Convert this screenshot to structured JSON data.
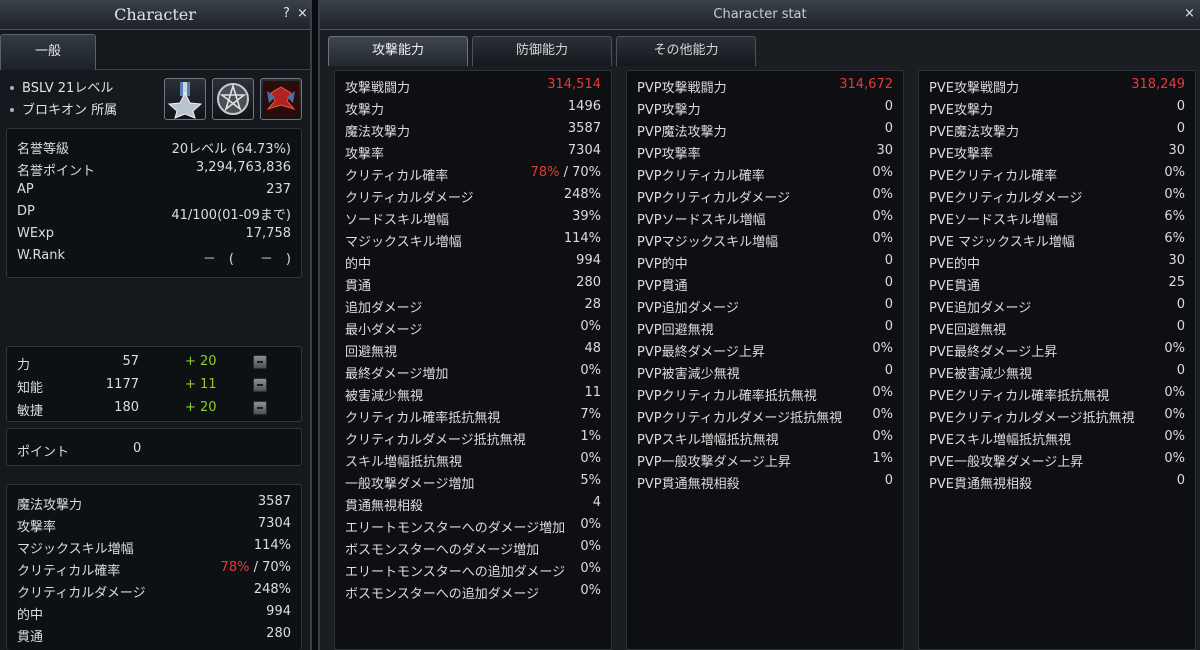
{
  "left": {
    "title": "Character",
    "help_label": "?",
    "close_label": "×",
    "tab_general": "一般",
    "info": [
      "BSLV 21レベル",
      "ブロキオン 所属"
    ],
    "emblems": [
      "medal-star-icon",
      "pentagram-icon",
      "legion-crest-icon"
    ],
    "honor": [
      {
        "k": "名誉等級",
        "v": "20レベル (64.73%)"
      },
      {
        "k": "名誉ポイント",
        "v": "3,294,763,836"
      },
      {
        "k": "AP",
        "v": "237"
      },
      {
        "k": "DP",
        "v": "41/100(01-09まで)"
      },
      {
        "k": "WExp",
        "v": "17,758"
      },
      {
        "k": "W.Rank",
        "v": "－　(　　－　)"
      }
    ],
    "base_stats": [
      {
        "k": "力",
        "v": "57",
        "bonus": "+ 20"
      },
      {
        "k": "知能",
        "v": "1177",
        "bonus": "+ 11"
      },
      {
        "k": "敏捷",
        "v": "180",
        "bonus": "+ 20"
      }
    ],
    "points": {
      "k": "ポイント",
      "v": "0"
    },
    "summary": [
      {
        "k": "魔法攻撃力",
        "v": "3587"
      },
      {
        "k": "攻撃率",
        "v": "7304"
      },
      {
        "k": "マジックスキル増幅",
        "v": "114%"
      },
      {
        "k": "クリティカル確率",
        "v_red": "78%",
        "v_rest": " / 70%"
      },
      {
        "k": "クリティカルダメージ",
        "v": "248%"
      },
      {
        "k": "的中",
        "v": "994"
      },
      {
        "k": "貫通",
        "v": "280"
      }
    ]
  },
  "right": {
    "title": "Character stat",
    "close_label": "×",
    "tabs": [
      "攻撃能力",
      "防御能力",
      "その他能力"
    ],
    "col1": [
      {
        "k": "攻撃戦闘力",
        "v": "314,514",
        "red": true
      },
      {
        "k": "攻撃力",
        "v": "1496"
      },
      {
        "k": "魔法攻撃力",
        "v": "3587"
      },
      {
        "k": "攻撃率",
        "v": "7304"
      },
      {
        "k": "クリティカル確率",
        "v_red": "78%",
        "v_rest": " / 70%"
      },
      {
        "k": "クリティカルダメージ",
        "v": "248%"
      },
      {
        "k": "ソードスキル増幅",
        "v": "39%"
      },
      {
        "k": "マジックスキル増幅",
        "v": "114%"
      },
      {
        "k": "的中",
        "v": "994"
      },
      {
        "k": "貫通",
        "v": "280"
      },
      {
        "k": "追加ダメージ",
        "v": "28"
      },
      {
        "k": "最小ダメージ",
        "v": "0%"
      },
      {
        "k": "回避無視",
        "v": "48"
      },
      {
        "k": "最終ダメージ増加",
        "v": "0%"
      },
      {
        "k": "被害減少無視",
        "v": "11"
      },
      {
        "k": "クリティカル確率抵抗無視",
        "v": "7%"
      },
      {
        "k": "クリティカルダメージ抵抗無視",
        "v": "1%"
      },
      {
        "k": "スキル増幅抵抗無視",
        "v": "0%"
      },
      {
        "k": "一般攻撃ダメージ増加",
        "v": "5%"
      },
      {
        "k": "貫通無視相殺",
        "v": "4"
      },
      {
        "k": "エリートモンスターへのダメージ増加",
        "v": "0%"
      },
      {
        "k": "ボスモンスターへのダメージ増加",
        "v": "0%"
      },
      {
        "k": "エリートモンスターへの追加ダメージ",
        "v": "0%"
      },
      {
        "k": "ボスモンスターへの追加ダメージ",
        "v": "0%"
      }
    ],
    "col2": [
      {
        "k": "PVP攻撃戦闘力",
        "v": "314,672",
        "red": true
      },
      {
        "k": "PVP攻撃力",
        "v": "0"
      },
      {
        "k": "PVP魔法攻撃力",
        "v": "0"
      },
      {
        "k": "PVP攻撃率",
        "v": "30"
      },
      {
        "k": "PVPクリティカル確率",
        "v": "0%"
      },
      {
        "k": "PVPクリティカルダメージ",
        "v": "0%"
      },
      {
        "k": "PVPソードスキル増幅",
        "v": "0%"
      },
      {
        "k": "PVPマジックスキル増幅",
        "v": "0%"
      },
      {
        "k": "PVP的中",
        "v": "0"
      },
      {
        "k": "PVP貫通",
        "v": "0"
      },
      {
        "k": "PVP追加ダメージ",
        "v": "0"
      },
      {
        "k": "PVP回避無視",
        "v": "0"
      },
      {
        "k": "PVP最終ダメージ上昇",
        "v": "0%"
      },
      {
        "k": "PVP被害減少無視",
        "v": "0"
      },
      {
        "k": "PVPクリティカル確率抵抗無視",
        "v": "0%"
      },
      {
        "k": "PVPクリティカルダメージ抵抗無視",
        "v": "0%"
      },
      {
        "k": "PVPスキル増幅抵抗無視",
        "v": "0%"
      },
      {
        "k": "PVP一般攻撃ダメージ上昇",
        "v": "1%"
      },
      {
        "k": "PVP貫通無視相殺",
        "v": "0"
      }
    ],
    "col3": [
      {
        "k": "PVE攻撃戦闘力",
        "v": "318,249",
        "red": true
      },
      {
        "k": "PVE攻撃力",
        "v": "0"
      },
      {
        "k": "PVE魔法攻撃力",
        "v": "0"
      },
      {
        "k": "PVE攻撃率",
        "v": "30"
      },
      {
        "k": "PVEクリティカル確率",
        "v": "0%"
      },
      {
        "k": "PVEクリティカルダメージ",
        "v": "0%"
      },
      {
        "k": "PVEソードスキル増幅",
        "v": "6%"
      },
      {
        "k": "PVE マジックスキル増幅",
        "v": "6%"
      },
      {
        "k": "PVE的中",
        "v": "30"
      },
      {
        "k": "PVE貫通",
        "v": "25"
      },
      {
        "k": "PVE追加ダメージ",
        "v": "0"
      },
      {
        "k": "PVE回避無視",
        "v": "0"
      },
      {
        "k": "PVE最終ダメージ上昇",
        "v": "0%"
      },
      {
        "k": "PVE被害減少無視",
        "v": "0"
      },
      {
        "k": "PVEクリティカル確率抵抗無視",
        "v": "0%"
      },
      {
        "k": "PVEクリティカルダメージ抵抗無視",
        "v": "0%"
      },
      {
        "k": "PVEスキル増幅抵抗無視",
        "v": "0%"
      },
      {
        "k": "PVE一般攻撃ダメージ上昇",
        "v": "0%"
      },
      {
        "k": "PVE貫通無視相殺",
        "v": "0"
      }
    ]
  },
  "colors": {
    "highlight_red": "#e53a3a",
    "bonus_green": "#8ccf2d"
  }
}
